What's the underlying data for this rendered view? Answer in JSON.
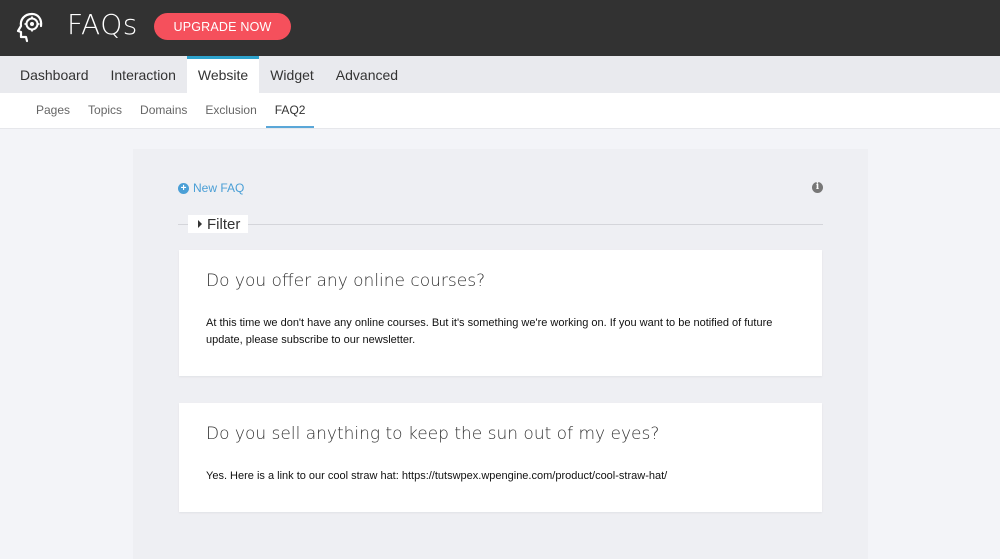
{
  "app": {
    "title": "FAQs",
    "upgrade_label": "UPGRADE NOW",
    "logo_icon": "head-gear-icon"
  },
  "main_nav": {
    "tabs": [
      {
        "label": "Dashboard",
        "active": false
      },
      {
        "label": "Interaction",
        "active": false
      },
      {
        "label": "Website",
        "active": true
      },
      {
        "label": "Widget",
        "active": false
      },
      {
        "label": "Advanced",
        "active": false
      }
    ]
  },
  "sub_nav": {
    "tabs": [
      {
        "label": "Pages",
        "active": false
      },
      {
        "label": "Topics",
        "active": false
      },
      {
        "label": "Domains",
        "active": false
      },
      {
        "label": "Exclusion",
        "active": false
      },
      {
        "label": "FAQ2",
        "active": true
      }
    ]
  },
  "content": {
    "new_faq_label": "New FAQ",
    "filter_label": "Filter",
    "info_icon": "info-icon",
    "faqs": [
      {
        "question": "Do you offer any online courses?",
        "answer": "At this time we don't have any online courses. But it's something we're working on. If you want to be notified of future update, please subscribe to our newsletter."
      },
      {
        "question": "Do you sell anything to keep the sun out of my eyes?",
        "answer": "Yes. Here is a link to our cool straw hat: https://tutswpex.wpengine.com/product/cool-straw-hat/"
      }
    ]
  },
  "colors": {
    "topbar": "#323232",
    "upgrade": "#f5505c",
    "accent": "#2ea2cc",
    "link": "#4a9fd6"
  }
}
